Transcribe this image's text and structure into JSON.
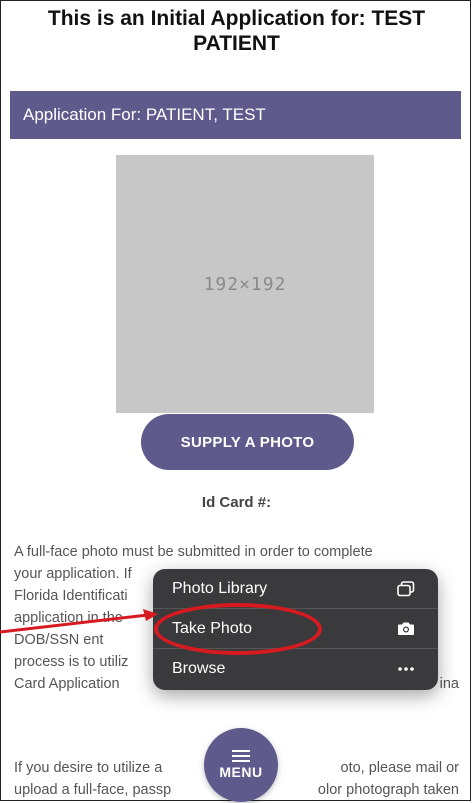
{
  "header": {
    "title_line1": "This is an Initial Application for: TEST",
    "title_line2": "PATIENT"
  },
  "app_bar": {
    "label": "Application For: PATIENT, TEST"
  },
  "photo": {
    "placeholder": "192×192"
  },
  "supply_button": {
    "label": "SUPPLY A PHOTO"
  },
  "id_card": {
    "label": "Id Card #:"
  },
  "paragraph1": {
    "lines": [
      "A full-face photo must be submitted in order to complete",
      "your application. If",
      "Florida Identificati",
      "application in the",
      "DOB/SSN ent",
      "process is to utiliz",
      "Card Application"
    ],
    "right_fragments": [
      "ina"
    ]
  },
  "paragraph2": {
    "line1_left": "If you desire to utilize a",
    "line1_right": "oto, please mail or",
    "line2_left": "upload a full-face, passp",
    "line2_right": "olor photograph taken"
  },
  "action_sheet": {
    "items": [
      {
        "label": "Photo Library",
        "icon": "photo-library-icon"
      },
      {
        "label": "Take Photo",
        "icon": "camera-icon"
      },
      {
        "label": "Browse",
        "icon": "more-icon"
      }
    ]
  },
  "menu": {
    "label": "MENU",
    "icon": "hamburger-icon"
  },
  "colors": {
    "accent": "#5e5a8c",
    "highlight": "#d71920",
    "sheet": "#3a3a3c"
  }
}
